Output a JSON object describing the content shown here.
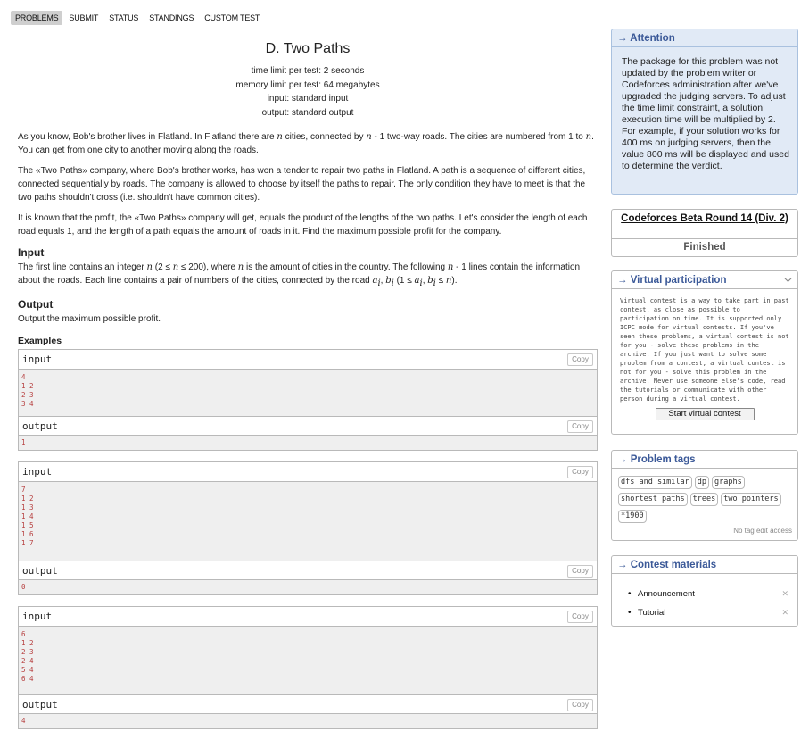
{
  "nav": {
    "items": [
      "PROBLEMS",
      "SUBMIT",
      "STATUS",
      "STANDINGS",
      "CUSTOM TEST"
    ]
  },
  "problem": {
    "title": "D. Two Paths",
    "time_limit": "time limit per test: 2 seconds",
    "memory_limit": "memory limit per test: 64 megabytes",
    "input": "input: standard input",
    "output": "output: standard output",
    "p1a": "As you know, Bob's brother lives in Flatland. In Flatland there are ",
    "p1_n": "n",
    "p1b": " cities, connected by ",
    "p1_n1": "n",
    "p1c": " - 1 two-way roads. The cities are numbered from 1 to ",
    "p1_n2": "n",
    "p1d": ". You can get from one city to another moving along the roads.",
    "p2": "The «Two Paths» company, where Bob's brother works, has won a tender to repair two paths in Flatland. A path is a sequence of different cities, connected sequentially by roads. The company is allowed to choose by itself the paths to repair. The only condition they have to meet is that the two paths shouldn't cross (i.e. shouldn't have common cities).",
    "p3": "It is known that the profit, the «Two Paths» company will get, equals the product of the lengths of the two paths. Let's consider the length of each road equals 1, and the length of a path equals the amount of roads in it. Find the maximum possible profit for the company.",
    "input_title": "Input",
    "input_a": "The first line contains an integer ",
    "input_n": "n",
    "input_b": " (2 ≤ ",
    "input_c": "n",
    "input_d": " ≤ 200), where ",
    "input_e": "n",
    "input_f": " is the amount of cities in the country. The following ",
    "input_g": "n",
    "input_h": " - 1 lines contain the information about the roads. Each line contains a pair of numbers of the cities, connected by the road ",
    "input_i": "a",
    "input_j": "i",
    "input_k": ", ",
    "input_l": "b",
    "input_m": "i",
    "input_o": " (1 ≤ ",
    "input_p": "a",
    "input_q": "i",
    "input_r": ", ",
    "input_s": "b",
    "input_t": "i",
    "input_u": " ≤ ",
    "input_v": "n",
    "input_w": ").",
    "output_title": "Output",
    "output_text": "Output the maximum possible profit.",
    "examples_title": "Examples"
  },
  "examples": [
    {
      "input_label": "input",
      "input": "4\n1 2\n2 3\n3 4",
      "output_label": "output",
      "output": "1",
      "copy": "Copy"
    },
    {
      "input_label": "input",
      "input": "7\n1 2\n1 3\n1 4\n1 5\n1 6\n1 7",
      "output_label": "output",
      "output": "0",
      "copy": "Copy"
    },
    {
      "input_label": "input",
      "input": "6\n1 2\n2 3\n2 4\n5 4\n6 4",
      "output_label": "output",
      "output": "4",
      "copy": "Copy"
    }
  ],
  "sidebar": {
    "attention_title": "→ Attention",
    "attention_text": "The package for this problem was not updated by the problem writer or Codeforces administration after we've upgraded the judging servers. To adjust the time limit constraint, a solution execution time will be multiplied by 2. For example, if your solution works for 400 ms on judging servers, then the value 800 ms will be displayed and used to determine the verdict.",
    "round_name": "Codeforces Beta Round 14 (Div. 2)",
    "round_status": "Finished",
    "virtual_title": "→ Virtual participation",
    "virtual_text": "Virtual contest is a way to take part in past contest, as close as possible to participation on time. It is supported only ICPC mode for virtual contests. If you've seen these problems, a virtual contest is not for you - solve these problems in the archive. If you just want to solve some problem from a contest, a virtual contest is not for you - solve this problem in the archive. Never use someone else's code, read the tutorials or communicate with other person during a virtual contest.",
    "virtual_button": "Start virtual contest",
    "tags_title": "→ Problem tags",
    "tags": [
      "dfs and similar",
      "dp",
      "graphs",
      "shortest paths",
      "trees",
      "two pointers",
      "*1900"
    ],
    "no_tag_edit": "No tag edit access",
    "materials_title": "→ Contest materials",
    "materials": [
      "Announcement",
      "Tutorial"
    ],
    "materials_x": "✕"
  },
  "colors": {
    "accent": "#3b5998",
    "attention_bg": "#e1eaf6",
    "sample_text": "#b63d3d"
  }
}
